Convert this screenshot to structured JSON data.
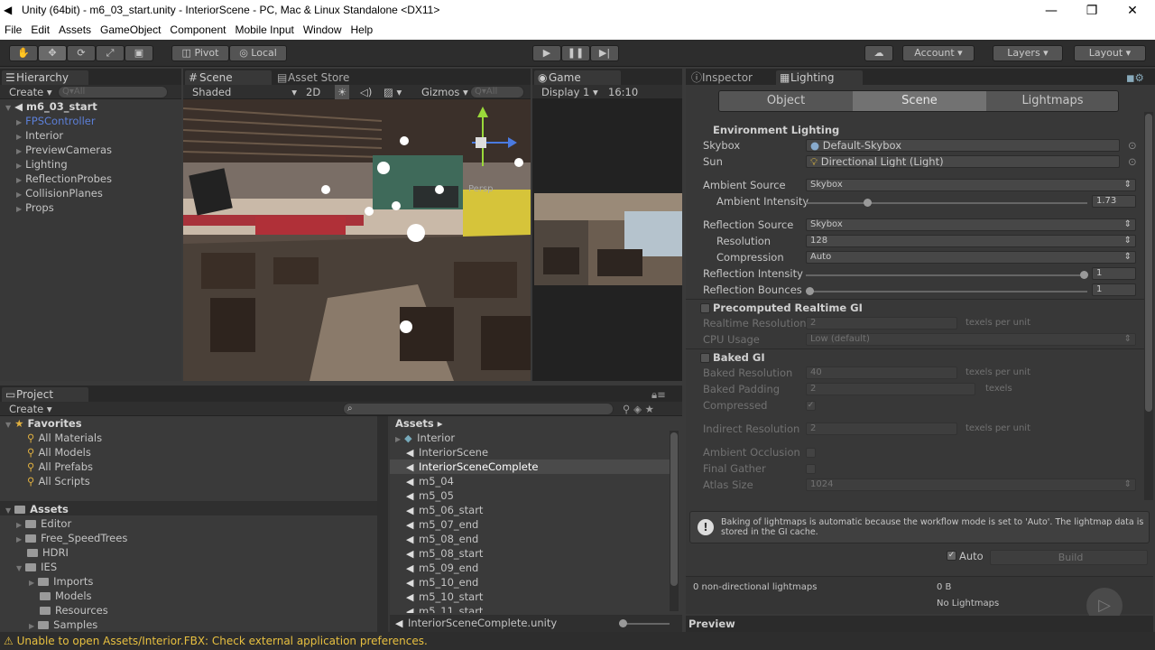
{
  "window": {
    "title": "Unity (64bit) - m6_03_start.unity - InteriorScene - PC, Mac & Linux Standalone <DX11>"
  },
  "menu": [
    "File",
    "Edit",
    "Assets",
    "GameObject",
    "Component",
    "Mobile Input",
    "Window",
    "Help"
  ],
  "toolbar": {
    "pivot": "Pivot",
    "local": "Local",
    "account": "Account",
    "layers": "Layers",
    "layout": "Layout"
  },
  "hierarchy": {
    "tab": "Hierarchy",
    "create": "Create",
    "search_placeholder": "Q▾All",
    "scene": "m6_03_start",
    "items": [
      "FPSController",
      "Interior",
      "PreviewCameras",
      "Lighting",
      "ReflectionProbes",
      "CollisionPlanes",
      "Props"
    ]
  },
  "scene": {
    "tab": "Scene",
    "store_tab": "Asset Store",
    "shaded": "Shaded",
    "mode2d": "2D",
    "gizmos": "Gizmos",
    "search": "Q▾All",
    "persp": "Persp"
  },
  "game": {
    "tab": "Game",
    "display": "Display 1",
    "aspect": "16:10"
  },
  "project": {
    "tab": "Project",
    "create": "Create",
    "favorites_header": "Favorites",
    "favorites": [
      "All Materials",
      "All Models",
      "All Prefabs",
      "All Scripts"
    ],
    "assets_header": "Assets",
    "folders": [
      "Editor",
      "Free_SpeedTrees",
      "HDRI",
      "IES",
      "Imports",
      "Models",
      "Resources",
      "Samples"
    ],
    "breadcrumb": "Assets",
    "files": [
      "Interior",
      "InteriorScene",
      "InteriorSceneComplete",
      "m5_04",
      "m5_05",
      "m5_06_start",
      "m5_07_end",
      "m5_08_end",
      "m5_08_start",
      "m5_09_end",
      "m5_10_end",
      "m5_10_start",
      "m5_11_start"
    ],
    "selected_path": "InteriorSceneComplete.unity"
  },
  "inspector": {
    "tab_inspector": "Inspector",
    "tab_lighting": "Lighting",
    "subtabs": [
      "Object",
      "Scene",
      "Lightmaps"
    ],
    "env_header": "Environment Lighting",
    "skybox_label": "Skybox",
    "skybox_value": "Default-Skybox",
    "sun_label": "Sun",
    "sun_value": "Directional Light (Light)",
    "ambient_source_label": "Ambient Source",
    "ambient_source_value": "Skybox",
    "ambient_intensity_label": "Ambient Intensity",
    "ambient_intensity_value": "1.73",
    "reflection_source_label": "Reflection Source",
    "reflection_source_value": "Skybox",
    "resolution_label": "Resolution",
    "resolution_value": "128",
    "compression_label": "Compression",
    "compression_value": "Auto",
    "reflection_intensity_label": "Reflection Intensity",
    "reflection_intensity_value": "1",
    "reflection_bounces_label": "Reflection Bounces",
    "reflection_bounces_value": "1",
    "precomputed_header": "Precomputed Realtime GI",
    "realtime_res_label": "Realtime Resolution",
    "realtime_res_value": "2",
    "texels_per_unit": "texels per unit",
    "cpu_usage_label": "CPU Usage",
    "cpu_usage_value": "Low (default)",
    "baked_header": "Baked GI",
    "baked_res_label": "Baked Resolution",
    "baked_res_value": "40",
    "baked_pad_label": "Baked Padding",
    "baked_pad_value": "2",
    "texels": "texels",
    "compressed_label": "Compressed",
    "indirect_res_label": "Indirect Resolution",
    "indirect_res_value": "2",
    "ao_label": "Ambient Occlusion",
    "final_gather_label": "Final Gather",
    "atlas_label": "Atlas Size",
    "atlas_value": "1024",
    "info": "Baking of lightmaps is automatic because the workflow mode is set to 'Auto'. The lightmap data is stored in the GI cache.",
    "auto_label": "Auto",
    "build_label": "Build",
    "lightmaps_count": "0 non-directional lightmaps",
    "lightmaps_size": "0 B",
    "no_lightmaps": "No Lightmaps",
    "preview_label": "Preview"
  },
  "status": {
    "message": "Unable to open Assets/Interior.FBX: Check external application preferences."
  }
}
